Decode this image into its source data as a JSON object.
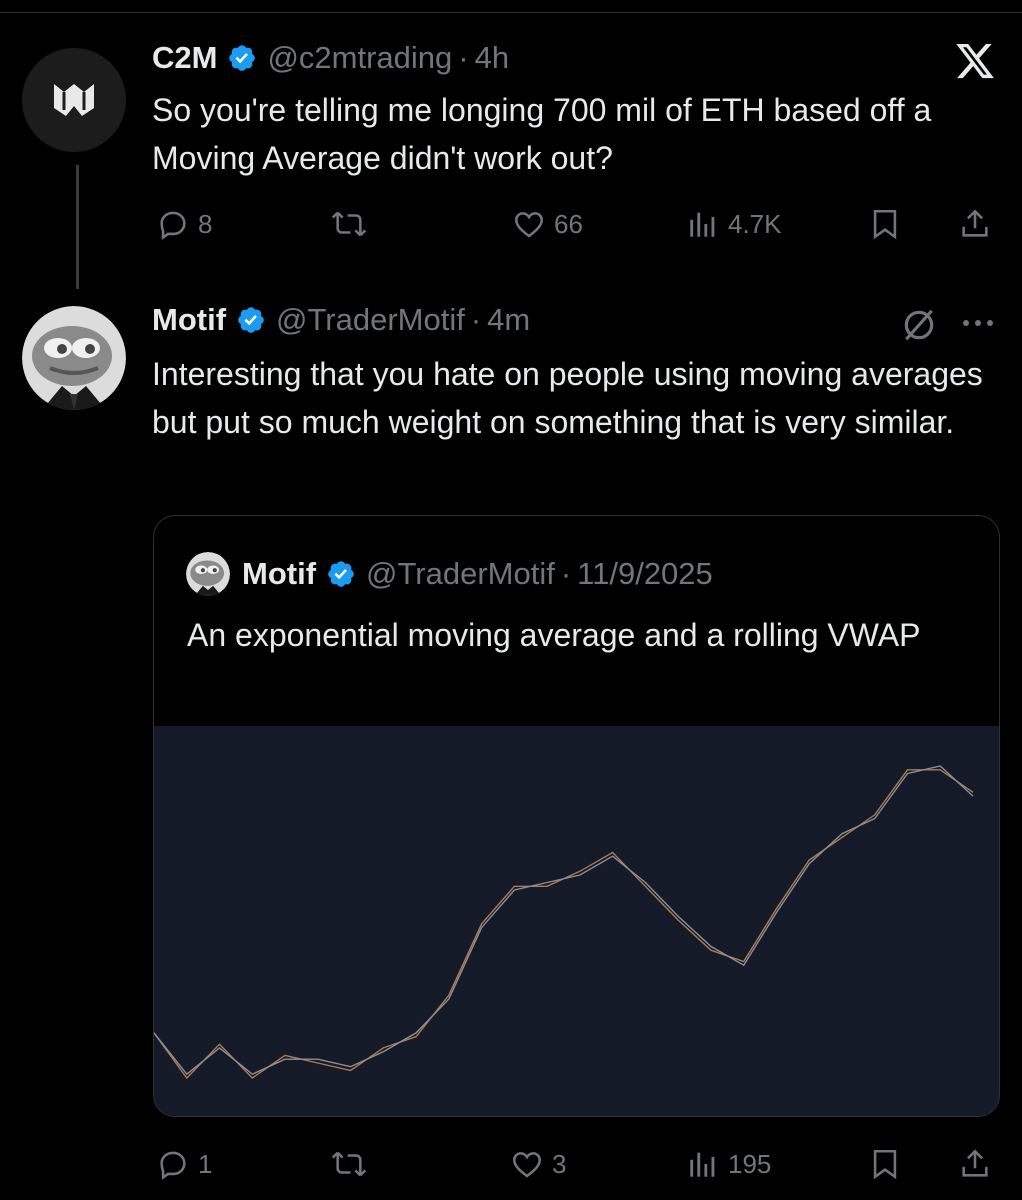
{
  "tweet1": {
    "name": "C2M",
    "handle": "@c2mtrading",
    "dot": "·",
    "time": "4h",
    "text": "So you're telling me longing 700 mil of ETH based off a Moving Average didn't work out?",
    "replies": "8",
    "likes": "66",
    "views": "4.7K"
  },
  "tweet2": {
    "name": "Motif",
    "handle": "@TraderMotif",
    "dot": "·",
    "time": "4m",
    "text": "Interesting that you hate on people using moving averages but put so much weight on something that is very similar.",
    "replies": "1",
    "likes": "3",
    "views": "195"
  },
  "quote": {
    "name": "Motif",
    "handle": "@TraderMotif",
    "dot": "·",
    "date": "11/9/2025",
    "text": "An exponential moving average and a rolling VWAP"
  },
  "chart_data": {
    "type": "line",
    "x": [
      0,
      4,
      8,
      12,
      16,
      20,
      24,
      28,
      32,
      36,
      40,
      44,
      48,
      52,
      56,
      60,
      64,
      68,
      72,
      76,
      80,
      84,
      88,
      92,
      96,
      100
    ],
    "series": [
      {
        "values": [
          72,
          60,
          69,
          60,
          66,
          64,
          62,
          68,
          71,
          82,
          101,
          111,
          111,
          115,
          120,
          111,
          102,
          94,
          91,
          105,
          118,
          124,
          130,
          142,
          142,
          136
        ]
      },
      {
        "values": [
          72,
          61,
          68,
          61,
          65,
          65,
          63,
          67,
          72,
          81,
          100,
          110,
          112,
          114,
          119,
          112,
          103,
          95,
          90,
          104,
          117,
          125,
          129,
          141,
          143,
          135
        ]
      }
    ],
    "colors": [
      "#b07a4a",
      "#8a8f99"
    ]
  },
  "icons": {
    "x_logo": "x-logo-icon",
    "grok": "grok-icon",
    "more": "more-icon",
    "reply": "reply-icon",
    "retweet": "retweet-icon",
    "like": "like-icon",
    "views": "views-icon",
    "bookmark": "bookmark-icon",
    "share": "share-icon",
    "verified": "verified-badge-icon"
  },
  "colors": {
    "background": "#000000",
    "text": "#e7e9ea",
    "muted": "#71767b",
    "verified": "#1d9bf0",
    "chart_bg": "#141a28"
  }
}
